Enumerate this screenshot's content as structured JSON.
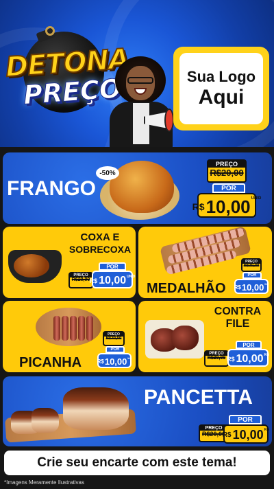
{
  "header": {
    "title_line1": "DETONA",
    "title_line2": "PREÇO",
    "logo_line1": "Sua Logo",
    "logo_line2": "Aqui"
  },
  "products": {
    "frango": {
      "name": "FRANGO",
      "discount": "-50%",
      "preco_label": "PREÇO",
      "old_price": "R$20,00",
      "por_label": "POR",
      "currency": "R$",
      "price": "10,00",
      "unit": "UNID"
    },
    "coxa": {
      "name_line1": "COXA E",
      "name_line2": "SOBRECOXA",
      "preco_label": "PREÇO",
      "old_price": "R$20,00",
      "por_label": "POR",
      "currency": "R$",
      "price": "10,00",
      "unit": "UNID"
    },
    "medalhao": {
      "name": "MEDALHÃO",
      "preco_label": "PREÇO",
      "old_price": "R$20,00",
      "por_label": "POR",
      "currency": "R$",
      "price": "10,00",
      "unit": "KG"
    },
    "picanha": {
      "name": "PICANHA",
      "preco_label": "PREÇO",
      "old_price": "R$20,00",
      "por_label": "POR",
      "currency": "R$",
      "price": "10,00",
      "unit": "KG"
    },
    "contrafile": {
      "name_line1": "CONTRA",
      "name_line2": "FILE",
      "preco_label": "PREÇO",
      "old_price": "R$20,00",
      "por_label": "POR",
      "currency": "R$",
      "price": "10,00",
      "unit": "KG"
    },
    "pancetta": {
      "name": "PANCETTA",
      "preco_label": "PREÇO",
      "old_price": "R$20,00",
      "por_label": "POR",
      "currency": "R$",
      "price": "10,00",
      "unit": "KG"
    }
  },
  "banner": "Crie seu encarte com este tema!",
  "footnote": "*Imagens Meramente Ilustrativas",
  "colors": {
    "blue": "#1b4fc4",
    "yellow": "#ffca0a",
    "dark": "#161616"
  }
}
